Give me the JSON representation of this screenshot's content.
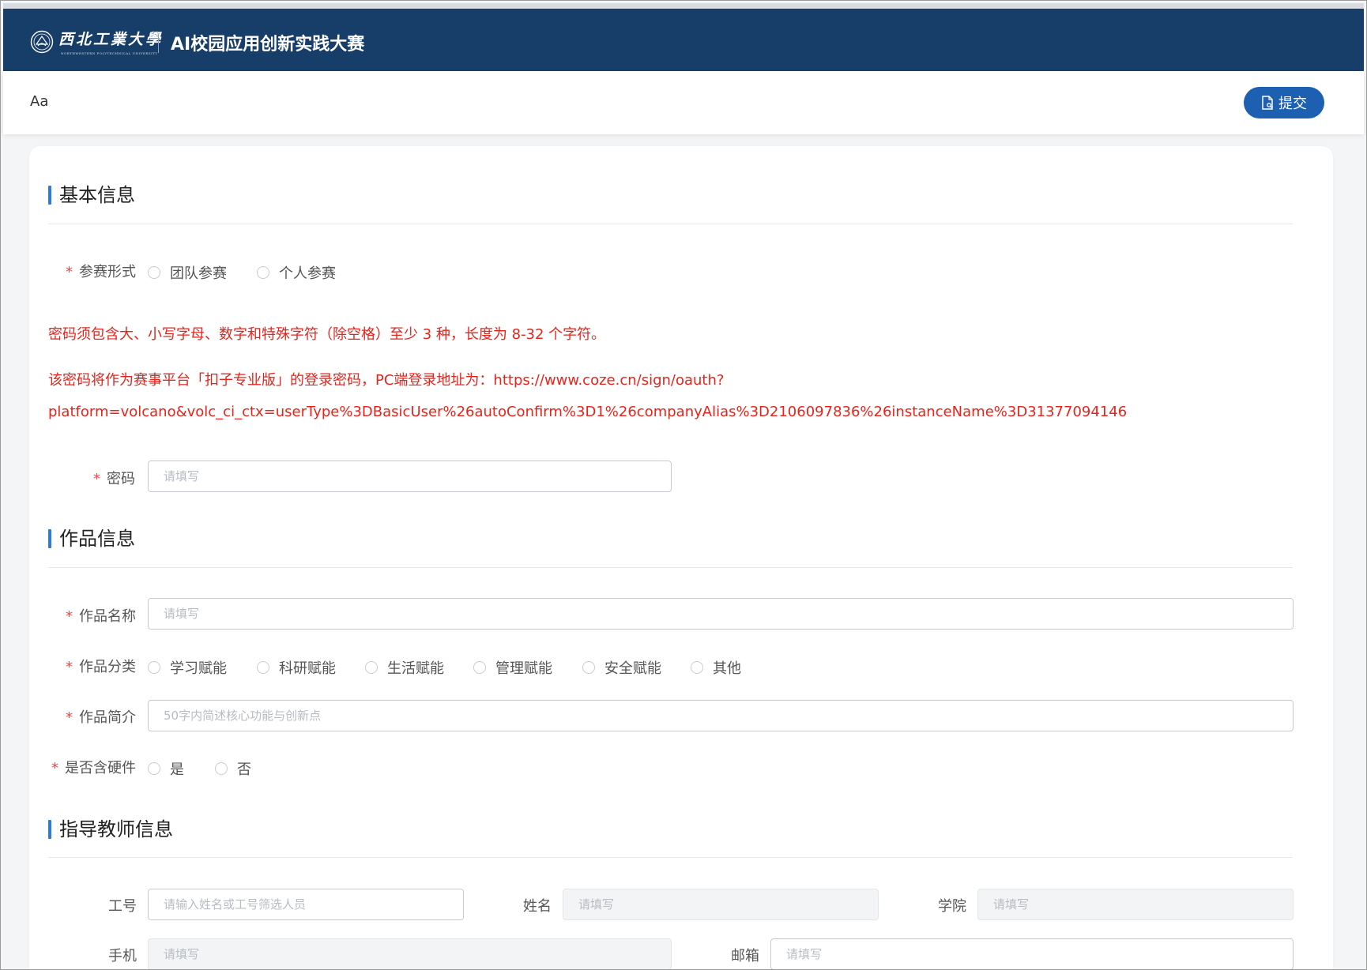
{
  "header": {
    "logo_text": "西北工業大學",
    "logo_sub": "NORTHWESTERN POLYTECHNICAL UNIVERSITY",
    "title": "AI校园应用创新实践大赛"
  },
  "toolbar": {
    "font_toggle": "Aa",
    "submit_label": "提交"
  },
  "sections": {
    "basic": {
      "title": "基本信息"
    },
    "work": {
      "title": "作品信息"
    },
    "teacher": {
      "title": "指导教师信息"
    }
  },
  "basic_info": {
    "participation": {
      "label": "参赛形式",
      "options": [
        "团队参赛",
        "个人参赛"
      ]
    },
    "notice_1": "密码须包含大、小写字母、数字和特殊字符（除空格）至少 3 种，长度为 8-32 个字符。",
    "notice_2": "该密码将作为赛事平台「扣子专业版」的登录密码，PC端登录地址为：https://www.coze.cn/sign/oauth?",
    "notice_3": "platform=volcano&volc_ci_ctx=userType%3DBasicUser%26autoConfirm%3D1%26companyAlias%3D2106097836%26instanceName%3D31377094146",
    "password": {
      "label": "密码",
      "placeholder": "请填写",
      "value": ""
    }
  },
  "work_info": {
    "name": {
      "label": "作品名称",
      "placeholder": "请填写",
      "value": ""
    },
    "category": {
      "label": "作品分类",
      "options": [
        "学习赋能",
        "科研赋能",
        "生活赋能",
        "管理赋能",
        "安全赋能",
        "其他"
      ]
    },
    "summary": {
      "label": "作品简介",
      "placeholder": "50字内简述核心功能与创新点",
      "value": ""
    },
    "hardware": {
      "label": "是否含硬件",
      "options": [
        "是",
        "否"
      ]
    }
  },
  "teacher_info": {
    "staff_id": {
      "label": "工号",
      "placeholder": "请输入姓名或工号筛选人员",
      "value": ""
    },
    "name": {
      "label": "姓名",
      "placeholder": "请填写",
      "value": ""
    },
    "college": {
      "label": "学院",
      "placeholder": "请填写",
      "value": ""
    },
    "phone": {
      "label": "手机",
      "placeholder": "请填写",
      "value": ""
    },
    "email": {
      "label": "邮箱",
      "placeholder": "请填写",
      "value": ""
    }
  },
  "colors": {
    "header_bg": "#173d69",
    "accent": "#1d5fb0",
    "section_bar": "#2d7ae0",
    "required_star": "#f04747",
    "notice_text": "#e8231a"
  },
  "icons": {
    "logo": "university-emblem-icon",
    "submit": "document-submit-icon",
    "radio": "radio-unchecked-icon"
  }
}
